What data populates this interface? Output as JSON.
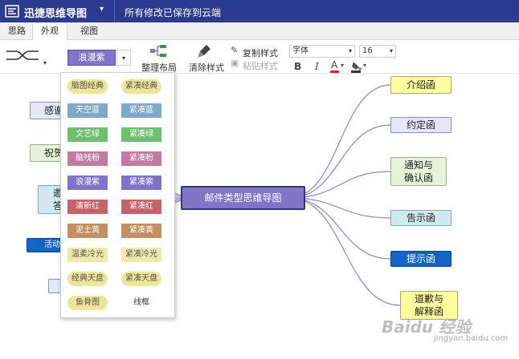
{
  "titlebar": {
    "app_title": "迅捷思维导图",
    "title_caret": "▾",
    "save_status": "所有修改已保存到云端"
  },
  "tabs": [
    {
      "label": "思路",
      "active": false
    },
    {
      "label": "外观",
      "active": true
    },
    {
      "label": "视图",
      "active": false
    }
  ],
  "toolbar": {
    "theme_label": "浪漫紫",
    "caret": "▾",
    "arrange_label": "整理布局",
    "clear_style_label": "清除样式",
    "copy_style_label": "复制样式",
    "paste_style_label": "粘贴样式",
    "font_value": "字体",
    "font_size_value": "16",
    "bold_label": "B",
    "italic_label": "I",
    "font_color_label": "A",
    "colors": {
      "accent": "#2a3b8f",
      "theme_purple": "#7f74c7",
      "font_color_bar": "#e02020",
      "highlight_color_bar": "#333333"
    }
  },
  "theme_dropdown": {
    "options": [
      {
        "label": "脑图经典",
        "bg": "#efe59a",
        "color": "#555555",
        "shape": "pill"
      },
      {
        "label": "紧凑经典",
        "bg": "#efe59a",
        "color": "#555555",
        "shape": "pill"
      },
      {
        "label": "天空蓝",
        "bg": "#7fa8c9",
        "color": "#ffffff",
        "shape": "rect"
      },
      {
        "label": "紧凑蓝",
        "bg": "#7fa8c9",
        "color": "#ffffff",
        "shape": "rect"
      },
      {
        "label": "文艺绿",
        "bg": "#6fbf73",
        "color": "#ffffff",
        "shape": "rect"
      },
      {
        "label": "紧凑绿",
        "bg": "#6fbf73",
        "color": "#ffffff",
        "shape": "rect"
      },
      {
        "label": "脑残粉",
        "bg": "#c27aa0",
        "color": "#ffffff",
        "shape": "rect"
      },
      {
        "label": "紧凑粉",
        "bg": "#c27aa0",
        "color": "#ffffff",
        "shape": "rect"
      },
      {
        "label": "浪漫紫",
        "bg": "#7f74c7",
        "color": "#ffffff",
        "shape": "rect"
      },
      {
        "label": "紧凑紫",
        "bg": "#7f74c7",
        "color": "#ffffff",
        "shape": "rect"
      },
      {
        "label": "清新红",
        "bg": "#c4636a",
        "color": "#ffffff",
        "shape": "rect"
      },
      {
        "label": "紧凑红",
        "bg": "#c4636a",
        "color": "#ffffff",
        "shape": "rect"
      },
      {
        "label": "泥土黄",
        "bg": "#c38e62",
        "color": "#ffffff",
        "shape": "rect"
      },
      {
        "label": "紧凑黄",
        "bg": "#c38e62",
        "color": "#ffffff",
        "shape": "rect"
      },
      {
        "label": "温柔冷光",
        "bg": "#f1e8ad",
        "color": "#555555",
        "shape": "rect"
      },
      {
        "label": "紧凑冷光",
        "bg": "#f1e8ad",
        "color": "#555555",
        "shape": "rect"
      },
      {
        "label": "经典天盘",
        "bg": "#efe59a",
        "color": "#555555",
        "shape": "pill"
      },
      {
        "label": "紧凑天盘",
        "bg": "#efe59a",
        "color": "#555555",
        "shape": "pill"
      },
      {
        "label": "鱼骨图",
        "bg": "#efe59a",
        "color": "#555555",
        "shape": "pill"
      },
      {
        "label": "线框",
        "bg": "#ffffff",
        "color": "#333333",
        "shape": "rect"
      }
    ]
  },
  "mindmap": {
    "central_topic": "邮件类型思维导图",
    "link_color": "#8a87c4",
    "right_nodes": [
      {
        "label": "介绍函",
        "style": "yellow"
      },
      {
        "label": "约定函",
        "style": "lavender"
      },
      {
        "label": "通知与\n确认函",
        "style": "green"
      },
      {
        "label": "告示函",
        "style": "cyan"
      },
      {
        "label": "提示函",
        "style": "blue"
      },
      {
        "label": "道歉与\n解释函",
        "style": "yellow"
      }
    ],
    "left_nodes": [
      {
        "label": "感谢",
        "style": "lavender"
      },
      {
        "label": "祝贺",
        "style": "green"
      },
      {
        "label": "邀\n答",
        "style": "cyan"
      },
      {
        "label": "活动",
        "style": "blue"
      },
      {
        "label": "",
        "style": "lavender"
      }
    ]
  },
  "watermark": {
    "text": "Baidu 经验",
    "url": "jingyan.baidu.com"
  }
}
